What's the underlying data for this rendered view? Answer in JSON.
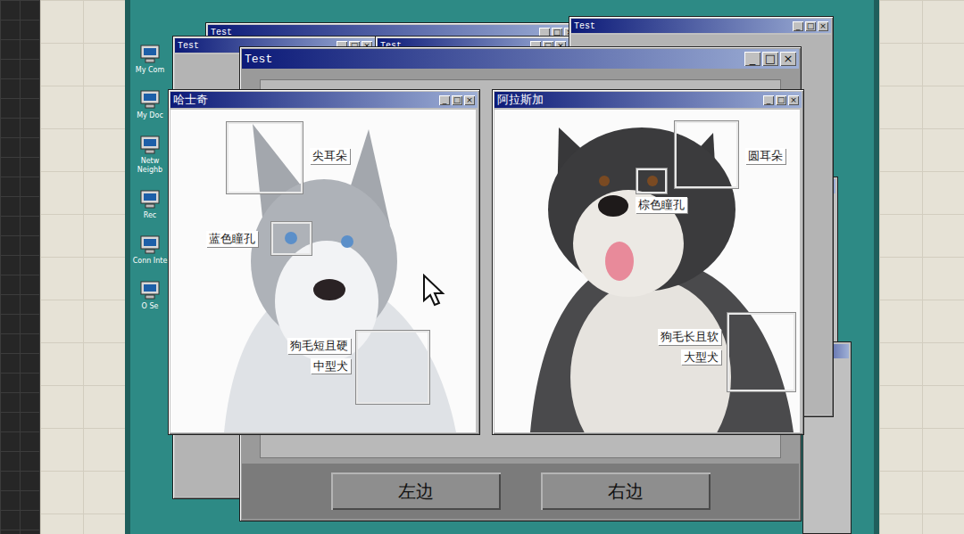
{
  "desktop_icons": [
    {
      "label": "My Com"
    },
    {
      "label": "My Doc"
    },
    {
      "label": "Netw Neighb"
    },
    {
      "label": "Rec"
    },
    {
      "label": "Conn Inte"
    },
    {
      "label": "O Se"
    }
  ],
  "window_controls": [
    "_",
    "□",
    "×"
  ],
  "background_windows": [
    {
      "title": "Test"
    },
    {
      "title": "Test"
    },
    {
      "title": "Test"
    },
    {
      "title": "Test"
    }
  ],
  "main_window": {
    "title": "Test",
    "buttons": [
      {
        "label": "左边"
      },
      {
        "label": "右边"
      }
    ]
  },
  "compare_windows": [
    {
      "title": "哈士奇",
      "annotations": [
        {
          "labels": [
            "尖耳朵"
          ]
        },
        {
          "labels": [
            "蓝色瞳孔"
          ]
        },
        {
          "labels": [
            "狗毛短且硬",
            "中型犬"
          ]
        }
      ]
    },
    {
      "title": "阿拉斯加",
      "annotations": [
        {
          "labels": [
            "圆耳朵"
          ]
        },
        {
          "labels": [
            "棕色瞳孔"
          ]
        },
        {
          "labels": [
            "狗毛长且软",
            "大型犬"
          ]
        }
      ]
    }
  ]
}
